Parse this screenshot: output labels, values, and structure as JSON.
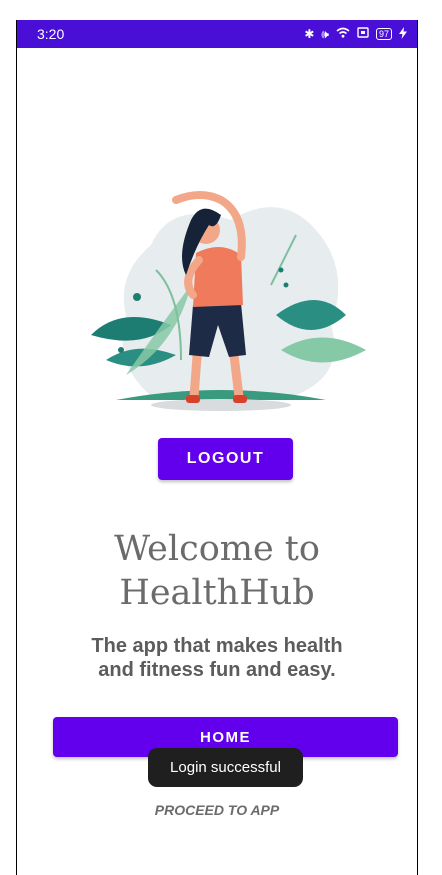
{
  "status_bar": {
    "time": "3:20",
    "battery_level": "97",
    "icons": [
      "bluetooth-icon",
      "vibrate-icon",
      "wifi-icon",
      "screen-cast-icon",
      "battery-icon",
      "charging-icon"
    ]
  },
  "main": {
    "logout_label": "LOGOUT",
    "welcome_line1": "Welcome to",
    "welcome_line2": "HealthHub",
    "tagline_line1": "The app that makes health",
    "tagline_line2": "and fitness fun and easy.",
    "home_label": "HOME",
    "proceed_label": "PROCEED TO APP"
  },
  "toast": {
    "message": "Login successful"
  },
  "colors": {
    "status_bar": "#4a0fd6",
    "primary_button": "#6200ee",
    "heading_text": "#6b6b6b",
    "toast_background": "#1f1f1f"
  }
}
